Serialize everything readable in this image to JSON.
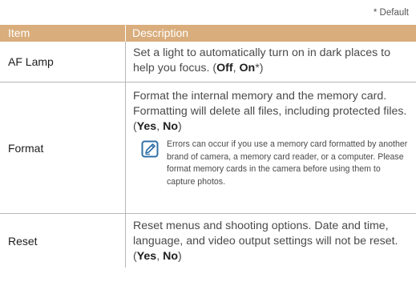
{
  "default_note": "* Default",
  "header": {
    "item": "Item",
    "description": "Description"
  },
  "rows": [
    {
      "item": "AF Lamp",
      "desc_1": "Set a light to automatically turn on in dark places to help you focus. (",
      "opt_1": "Off",
      "sep": ", ",
      "opt_2": "On",
      "suffix": "*)"
    },
    {
      "item": "Format",
      "desc_1": "Format the internal memory and the memory card. Formatting will delete all files, including protected files. (",
      "opt_1": "Yes",
      "sep": ", ",
      "opt_2": "No",
      "suffix": ")",
      "note": "Errors can occur if you use a memory card formatted by another brand of camera, a memory card reader, or a computer. Please format memory cards in the camera before using them to capture photos."
    },
    {
      "item": "Reset",
      "desc_1": "Reset menus and shooting options. Date and time, language, and video output settings will not be reset. (",
      "opt_1": "Yes",
      "sep": ", ",
      "opt_2": "No",
      "suffix": ")"
    }
  ],
  "colors": {
    "header_bg": "#d9ad7c",
    "accent": "#2f6fa8"
  },
  "icons": {
    "note": "note-pencil-icon"
  }
}
